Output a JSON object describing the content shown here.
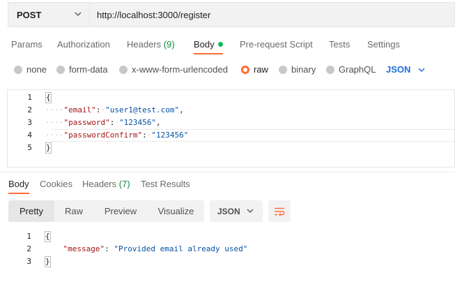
{
  "request": {
    "method": "POST",
    "url": "http://localhost:3000/register"
  },
  "request_tabs": [
    {
      "label": "Params"
    },
    {
      "label": "Authorization"
    },
    {
      "label": "Headers",
      "count": "(9)"
    },
    {
      "label": "Body"
    },
    {
      "label": "Pre-request Script"
    },
    {
      "label": "Tests"
    },
    {
      "label": "Settings"
    }
  ],
  "body_types": [
    {
      "label": "none"
    },
    {
      "label": "form-data"
    },
    {
      "label": "x-www-form-urlencoded"
    },
    {
      "label": "raw"
    },
    {
      "label": "binary"
    },
    {
      "label": "GraphQL"
    }
  ],
  "body_language": "JSON",
  "request_body": {
    "line_numbers": [
      "1",
      "2",
      "3",
      "4",
      "5"
    ],
    "open_brace": "{",
    "close_brace": "}",
    "email_key": "\"email\"",
    "email_value": "\"user1@test.com\"",
    "password_key": "\"password\"",
    "password_value": "\"123456\"",
    "confirm_key": "\"passwordConfirm\"",
    "confirm_value": "\"123456\""
  },
  "response_tabs": [
    {
      "label": "Body"
    },
    {
      "label": "Cookies"
    },
    {
      "label": "Headers",
      "count": "(7)"
    },
    {
      "label": "Test Results"
    }
  ],
  "response_view_modes": [
    {
      "label": "Pretty"
    },
    {
      "label": "Raw"
    },
    {
      "label": "Preview"
    },
    {
      "label": "Visualize"
    }
  ],
  "response_format": "JSON",
  "response_body": {
    "line_numbers": [
      "1",
      "2",
      "3"
    ],
    "open_brace": "{",
    "close_brace": "}",
    "message_key": "\"message\"",
    "message_value": "\"Provided email already used\""
  },
  "colors": {
    "accent": "#ff6c37",
    "link_blue": "#1e6fd9",
    "status_green": "#0cbb52",
    "json_key": "#a31515",
    "json_string": "#0451a5"
  },
  "icons": {
    "method_dropdown": "chevron-down-icon",
    "language_dropdown": "chevron-down-icon",
    "format_dropdown": "chevron-down-icon",
    "wrap": "wrap-lines-icon"
  }
}
